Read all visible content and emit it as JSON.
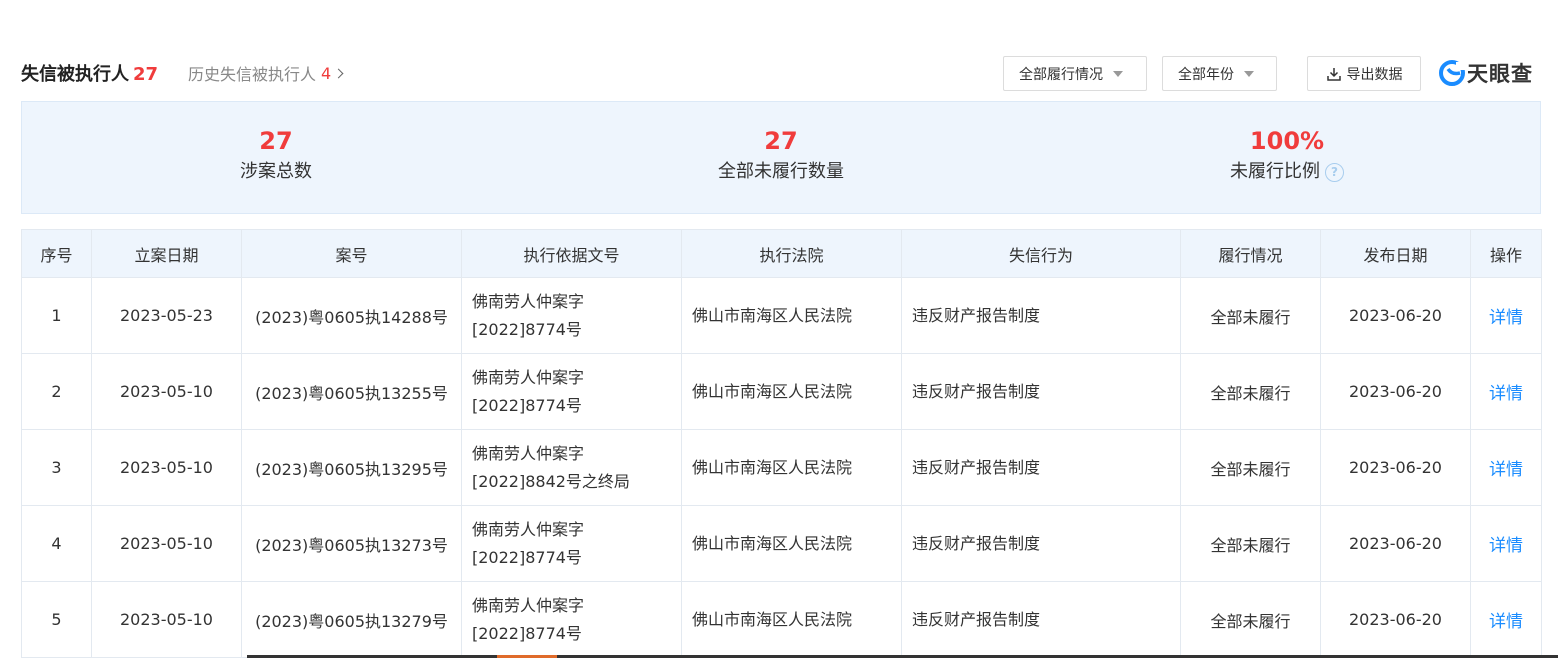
{
  "header": {
    "title": "失信被执行人",
    "title_count": "27",
    "history_label": "历史失信被执行人",
    "history_count": "4",
    "filter_performance": "全部履行情况",
    "filter_year": "全部年份",
    "export_label": "导出数据",
    "logo_text": "天眼查"
  },
  "stats": [
    {
      "value": "27",
      "label": "涉案总数"
    },
    {
      "value": "27",
      "label": "全部未履行数量"
    },
    {
      "value": "100%",
      "label": "未履行比例"
    }
  ],
  "help_glyph": "?",
  "table": {
    "columns": [
      "序号",
      "立案日期",
      "案号",
      "执行依据文号",
      "执行法院",
      "失信行为",
      "履行情况",
      "发布日期",
      "操作"
    ],
    "rows": [
      {
        "no": "1",
        "filed": "2023-05-23",
        "case": "(2023)粤0605执14288号",
        "basis_1": "佛南劳人仲案字",
        "basis_2": "[2022]8774号",
        "court": "佛山市南海区人民法院",
        "behavior": "违反财产报告制度",
        "status": "全部未履行",
        "published": "2023-06-20",
        "action": "详情"
      },
      {
        "no": "2",
        "filed": "2023-05-10",
        "case": "(2023)粤0605执13255号",
        "basis_1": "佛南劳人仲案字",
        "basis_2": "[2022]8774号",
        "court": "佛山市南海区人民法院",
        "behavior": "违反财产报告制度",
        "status": "全部未履行",
        "published": "2023-06-20",
        "action": "详情"
      },
      {
        "no": "3",
        "filed": "2023-05-10",
        "case": "(2023)粤0605执13295号",
        "basis_1": "佛南劳人仲案字",
        "basis_2": "[2022]8842号之终局",
        "court": "佛山市南海区人民法院",
        "behavior": "违反财产报告制度",
        "status": "全部未履行",
        "published": "2023-06-20",
        "action": "详情"
      },
      {
        "no": "4",
        "filed": "2023-05-10",
        "case": "(2023)粤0605执13273号",
        "basis_1": "佛南劳人仲案字",
        "basis_2": "[2022]8774号",
        "court": "佛山市南海区人民法院",
        "behavior": "违反财产报告制度",
        "status": "全部未履行",
        "published": "2023-06-20",
        "action": "详情"
      },
      {
        "no": "5",
        "filed": "2023-05-10",
        "case": "(2023)粤0605执13279号",
        "basis_1": "佛南劳人仲案字",
        "basis_2": "[2022]8774号",
        "court": "佛山市南海区人民法院",
        "behavior": "违反财产报告制度",
        "status": "全部未履行",
        "published": "2023-06-20",
        "action": "详情"
      }
    ]
  },
  "colors": {
    "accent_red": "#f03c3c",
    "link_blue": "#1a8cff",
    "logo_blue": "#1a8cff",
    "panel_bg": "#eef5fd"
  }
}
